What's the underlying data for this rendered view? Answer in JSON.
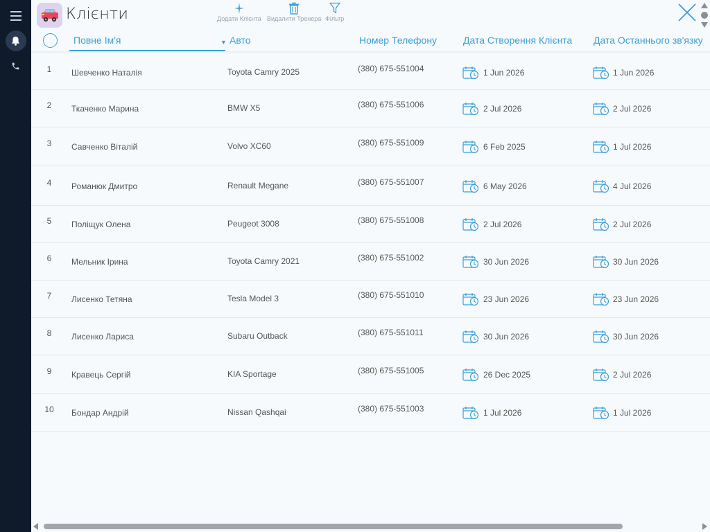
{
  "header": {
    "title": "Клієнти",
    "tools": [
      {
        "label": "Додати Клієнта",
        "icon": "sparkle-add-icon"
      },
      {
        "label": "Видалити Тренера",
        "icon": "trash-icon"
      },
      {
        "label": "Фільтр",
        "icon": "filter-icon"
      }
    ]
  },
  "sidebar": {
    "items": [
      {
        "icon": "menu-icon"
      },
      {
        "icon": "bell-icon"
      },
      {
        "icon": "phone-icon"
      }
    ]
  },
  "columns": [
    {
      "label": "Повне Ім'я"
    },
    {
      "label": "Авто"
    },
    {
      "label": "Номер Телефону"
    },
    {
      "label": "Дата Створення Клієнта"
    },
    {
      "label": "Дата Останнього зв'язку"
    }
  ],
  "sort": {
    "column": "Повне Ім'я",
    "direction": "desc"
  },
  "accent_color": "#3a9fd6",
  "rows": [
    {
      "num": "1",
      "name": "Шевченко Наталія",
      "car": "Toyota Camry 2025",
      "phone": "(380) 675-551004",
      "created": "1 Jun 2026",
      "last_contact": "1 Jun 2026"
    },
    {
      "num": "2",
      "name": "Ткаченко Марина",
      "car": "BMW X5",
      "phone": "(380) 675-551006",
      "created": "2 Jul 2026",
      "last_contact": "2 Jul 2026"
    },
    {
      "num": "3",
      "name": "Савченко Віталій",
      "car": "Volvo XC60",
      "phone": "(380) 675-551009",
      "created": "6 Feb 2025",
      "last_contact": "1 Jul 2026"
    },
    {
      "num": "4",
      "name": "Романюк Дмитро",
      "car": "Renault Megane",
      "phone": "(380) 675-551007",
      "created": "6 May 2026",
      "last_contact": "4 Jul 2026"
    },
    {
      "num": "5",
      "name": "Поліщук Олена",
      "car": "Peugeot 3008",
      "phone": "(380) 675-551008",
      "created": "2 Jul 2026",
      "last_contact": "2 Jul 2026"
    },
    {
      "num": "6",
      "name": "Мельник Ірина",
      "car": "Toyota Camry 2021",
      "phone": "(380) 675-551002",
      "created": "30 Jun 2026",
      "last_contact": "30 Jun 2026"
    },
    {
      "num": "7",
      "name": "Лисенко Тетяна",
      "car": "Tesla Model 3",
      "phone": "(380) 675-551010",
      "created": "23 Jun 2026",
      "last_contact": "23 Jun 2026"
    },
    {
      "num": "8",
      "name": "Лисенко Лариса",
      "car": "Subaru Outback",
      "phone": "(380) 675-551011",
      "created": "30 Jun 2026",
      "last_contact": "30 Jun 2026"
    },
    {
      "num": "9",
      "name": "Кравець Сергій",
      "car": "KIA Sportage",
      "phone": "(380) 675-551005",
      "created": "26 Dec 2025",
      "last_contact": "2 Jul 2026"
    },
    {
      "num": "10",
      "name": "Бондар Андрій",
      "car": "Nissan Qashqai",
      "phone": "(380) 675-551003",
      "created": "1 Jul 2026",
      "last_contact": "1 Jul 2026"
    }
  ]
}
